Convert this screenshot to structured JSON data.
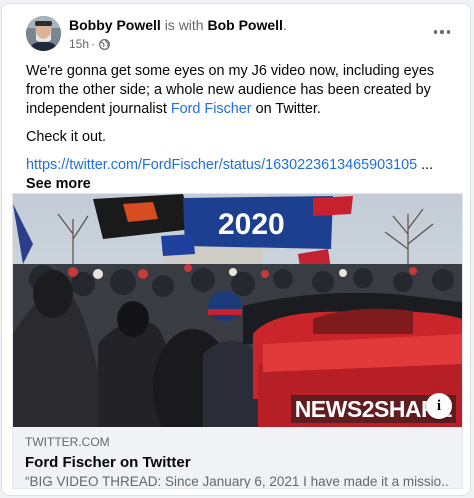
{
  "post": {
    "author": "Bobby Powell",
    "with_text": "is with",
    "tagged": "Bob Powell",
    "period": ".",
    "time": "15h",
    "separator": "·",
    "paragraph1_pre": "We're gonna get some eyes on my J6 video now, including eyes from the other side; a whole new audience has been created by independent journalist ",
    "paragraph1_link": "Ford Fischer",
    "paragraph1_post": " on Twitter.",
    "paragraph2": "Check it out.",
    "url": "https://twitter.com/FordFischer/status/1630223613465903105",
    "ellipsis": " ... ",
    "see_more": "See more",
    "icons": {
      "privacy": "globe-icon",
      "menu": "more-options-icon",
      "info": "info-icon"
    }
  },
  "preview": {
    "domain": "TWITTER.COM",
    "title": "Ford Fischer on Twitter",
    "description": "“BIG VIDEO THREAD: Since January 6, 2021 I have made it a missio...",
    "image_watermark": "NEWS2SHARE",
    "info_label": "i",
    "banner_text": "2020"
  }
}
